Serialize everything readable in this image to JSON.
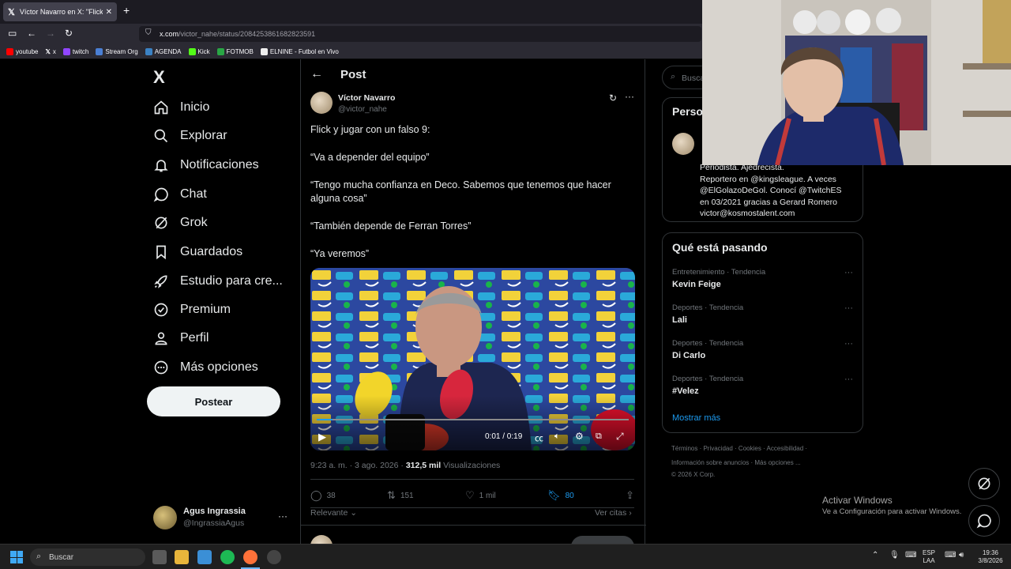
{
  "browser": {
    "tab_title": "Víctor Navarro en X: \"Flick y juga...",
    "url_host": "x.com",
    "url_path": "/victor_nahe/status/2084253861682823591",
    "bookmarks": [
      "youtube",
      "x",
      "twitch",
      "Stream Org",
      "AGENDA",
      "Kick",
      "FOTMOB",
      "ELNINE - Futbol en Vivo"
    ]
  },
  "sidebar": {
    "logo": "X",
    "items": [
      {
        "label": "Inicio",
        "icon": "home-icon"
      },
      {
        "label": "Explorar",
        "icon": "search-icon"
      },
      {
        "label": "Notificaciones",
        "icon": "bell-icon"
      },
      {
        "label": "Chat",
        "icon": "chat-icon"
      },
      {
        "label": "Grok",
        "icon": "grok-icon"
      },
      {
        "label": "Guardados",
        "icon": "bookmark-icon"
      },
      {
        "label": "Estudio para cre...",
        "icon": "rocket-icon"
      },
      {
        "label": "Premium",
        "icon": "verified-icon"
      },
      {
        "label": "Perfil",
        "icon": "person-icon"
      },
      {
        "label": "Más opciones",
        "icon": "more-circle-icon"
      }
    ],
    "post_button": "Postear",
    "account": {
      "name": "Agus Ingrassia",
      "handle": "@IngrassiaAgus"
    }
  },
  "post": {
    "header": "Post",
    "author_name": "Víctor Navarro",
    "author_handle": "@victor_nahe",
    "lines": [
      "Flick y jugar con un falso 9:",
      "“Va a depender del equipo”",
      "“Tengo mucha confianza en Deco. Sabemos que tenemos que hacer alguna cosa”",
      "“También depende de Ferran Torres”",
      "“Ya veremos”"
    ],
    "video": {
      "time": "0:01 / 0:19",
      "progress": 0.05
    },
    "timestamp": "9:23 a. m. · 3 ago. 2026 · ",
    "views_count": "312,5 mil",
    "views_label": " Visualizaciones",
    "replies": "38",
    "reposts": "151",
    "likes": "1 mil",
    "bookmarks": "80",
    "relevant": "Relevante",
    "quotes": "Ver citas"
  },
  "right": {
    "search_placeholder": "Buscar",
    "profile_card_title": "Perso",
    "bio_lines": [
      "Periodista. Ajedrecista.",
      "Reportero en @kingsleague. A veces",
      "@ElGolazoDeGol. Conocí @TwitchES",
      "en 03/2021 gracias a Gerard Romero",
      "victor@kosmostalent.com"
    ],
    "trending_title": "Qué está pasando",
    "trends": [
      {
        "category": "Entretenimiento · Tendencia",
        "name": "Kevin Feige"
      },
      {
        "category": "Deportes · Tendencia",
        "name": "Lali"
      },
      {
        "category": "Deportes · Tendencia",
        "name": "Di Carlo"
      },
      {
        "category": "Deportes · Tendencia",
        "name": "#Velez"
      }
    ],
    "show_more": "Mostrar más",
    "footer": [
      "Términos",
      "Privacidad",
      "Cookies",
      "Accesibilidad",
      "Información sobre anuncios",
      "Más opciones ...",
      "© 2026 X Corp."
    ]
  },
  "windows": {
    "activate_title": "Activar Windows",
    "activate_sub": "Ve a Configuración para activar Windows.",
    "search": "Buscar",
    "lang": "ESP",
    "lang2": "LAA",
    "time": "19:36",
    "date": "3/8/2026"
  },
  "colors": {
    "accent": "#1d9bf0",
    "bg": "#000000",
    "muted": "#71767b"
  }
}
